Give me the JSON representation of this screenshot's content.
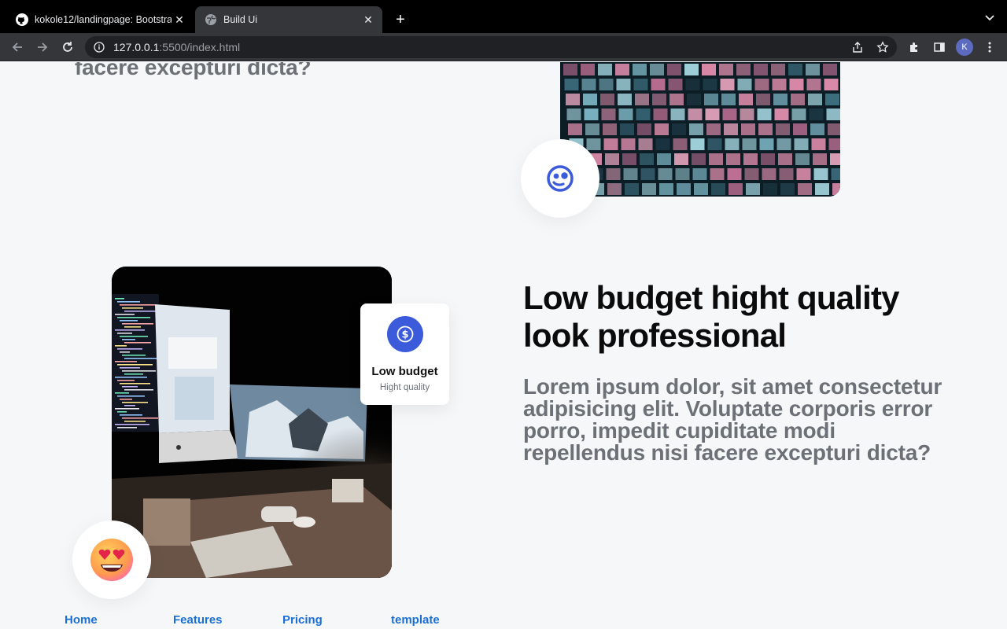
{
  "browser": {
    "tabs": [
      {
        "title": "kokole12/landingpage: Bootstra",
        "icon": "github-icon",
        "active": false
      },
      {
        "title": "Build Ui",
        "icon": "globe-icon",
        "active": true
      }
    ],
    "url_host": "127.0.0.1",
    "url_rest": ":5500/index.html",
    "profile_initial": "K"
  },
  "page": {
    "lead_text": "cupiditate modi repellendus nisi facere excepturi dicta?",
    "feature_card": {
      "title": "Low budget",
      "subtitle": "Hight quality"
    },
    "heading": "Low budget hight quality look professional",
    "body_text": "Lorem ipsum dolor, sit amet consectetur adipisicing elit. Voluptate corporis error porro, impedit cupiditate modi repellendus nisi facere excepturi dicta?",
    "footer_nav": [
      "Home",
      "Features",
      "Pricing",
      "template"
    ],
    "colors": {
      "accent": "#3b5bdb",
      "link": "#1a6fd6",
      "muted_text": "#6b7176"
    }
  }
}
